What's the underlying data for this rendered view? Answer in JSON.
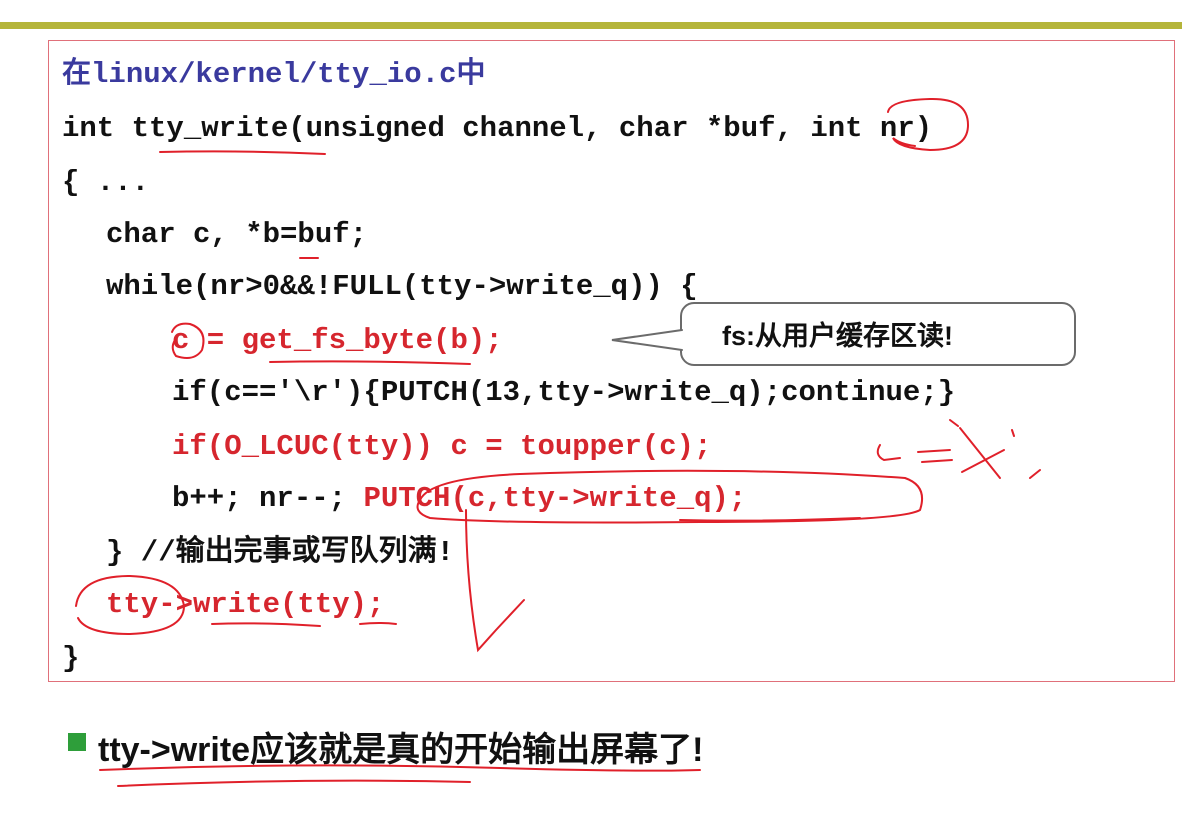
{
  "code": {
    "line1_prefix": "在",
    "line1_path": "linux/kernel/tty_io.c",
    "line1_suffix": "中",
    "line2": "int tty_write(unsigned channel, char *buf, int nr)",
    "line3": "{ ...",
    "line4": "char c, *b=buf;",
    "line5": "while(nr>0&&!FULL(tty->write_q)) {",
    "line6": "c = get_fs_byte(b);",
    "line7": "if(c=='\\r'){PUTCH(13,tty->write_q);continue;}",
    "line8": "if(O_LCUC(tty)) c = toupper(c);",
    "line9_a": "b++; nr--; ",
    "line9_b": "PUTCH(c,tty->write_q);",
    "line10": "} //输出完事或写队列满!",
    "line11": "tty->write(tty);",
    "line12": "}"
  },
  "callout": {
    "text": "fs:从用户缓存区读!"
  },
  "bottom": {
    "text": "tty->write应该就是真的开始输出屏幕了!"
  },
  "colors": {
    "red": "#d6262e",
    "bar": "#b5b53a",
    "bullet": "#2e9e3a",
    "blue": "#3a3a9e"
  }
}
